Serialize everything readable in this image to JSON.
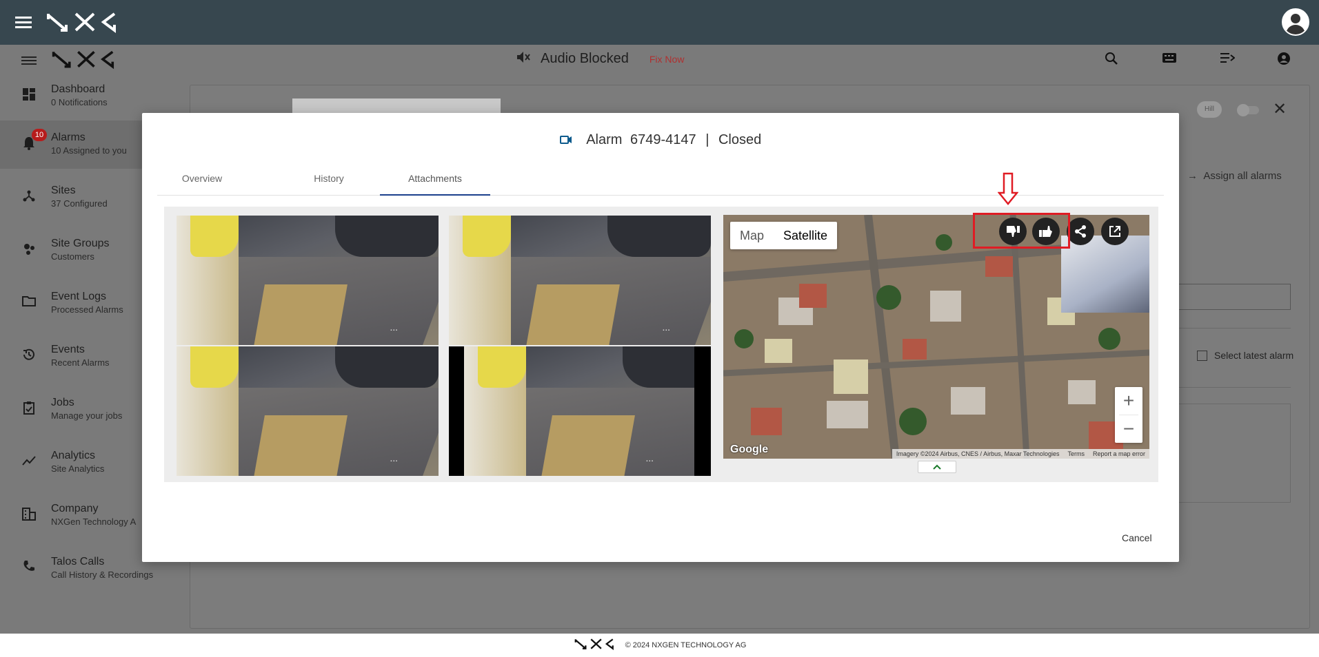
{
  "topbar": {
    "logo": "NXG"
  },
  "header": {
    "audio_text": "Audio Blocked",
    "fix_now": "Fix Now"
  },
  "sidebar": {
    "items": [
      {
        "title": "Dashboard",
        "subtitle": "0 Notifications",
        "icon": "dashboard-icon"
      },
      {
        "title": "Alarms",
        "subtitle": "10 Assigned to you",
        "icon": "bell-icon",
        "badge": "10"
      },
      {
        "title": "Sites",
        "subtitle": "37 Configured",
        "icon": "sites-icon"
      },
      {
        "title": "Site Groups",
        "subtitle": "Customers",
        "icon": "site-groups-icon"
      },
      {
        "title": "Event Logs",
        "subtitle": "Processed Alarms",
        "icon": "folder-icon"
      },
      {
        "title": "Events",
        "subtitle": "Recent Alarms",
        "icon": "history-icon"
      },
      {
        "title": "Jobs",
        "subtitle": "Manage your jobs",
        "icon": "jobs-icon"
      },
      {
        "title": "Analytics",
        "subtitle": "Site Analytics",
        "icon": "analytics-icon"
      },
      {
        "title": "Company",
        "subtitle": "NXGen Technology A",
        "icon": "company-icon"
      },
      {
        "title": "Talos Calls",
        "subtitle": "Call History & Recordings",
        "icon": "phone-icon"
      }
    ]
  },
  "background_panel": {
    "assign_all": "Assign all alarms",
    "select_latest": "Select latest alarm",
    "hill": "Hill"
  },
  "modal": {
    "title_alarm": "Alarm",
    "title_id": "6749-4147",
    "title_sep": "|",
    "title_status": "Closed",
    "tabs": [
      "Overview",
      "History",
      "Attachments"
    ],
    "active_tab": "Attachments",
    "cancel": "Cancel"
  },
  "map": {
    "type_map": "Map",
    "type_satellite": "Satellite",
    "attribution": "Imagery ©2024 Airbus, CNES / Airbus, Maxar Technologies",
    "terms": "Terms",
    "report": "Report a map error",
    "google": "Google",
    "zoom_in": "+",
    "zoom_out": "−"
  },
  "footer": {
    "copyright": "© 2024 NXGEN TECHNOLOGY AG"
  },
  "colors": {
    "topbar": "#37474f",
    "highlight": "#e01c24",
    "tab_active": "#1a3f8c",
    "fix_now": "#b03030"
  }
}
